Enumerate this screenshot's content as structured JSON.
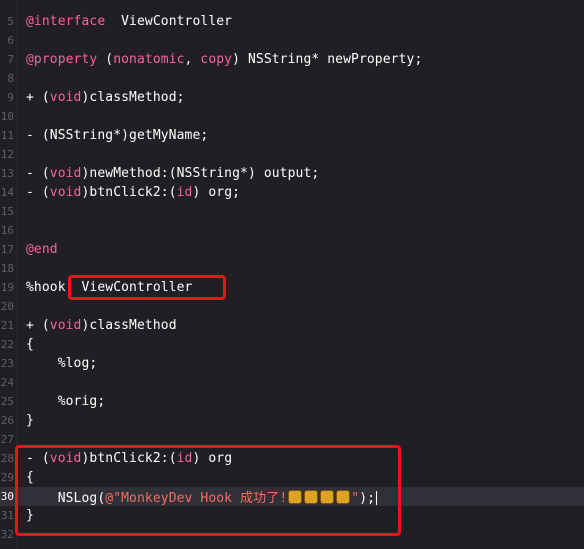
{
  "editor": {
    "lines": [
      {
        "num": "5",
        "segments": [
          {
            "t": "@interface",
            "c": "kw"
          },
          {
            "t": "  ViewController",
            "c": "plain"
          }
        ]
      },
      {
        "num": "6",
        "segments": []
      },
      {
        "num": "7",
        "segments": [
          {
            "t": "@property",
            "c": "kw"
          },
          {
            "t": " (",
            "c": "plain"
          },
          {
            "t": "nonatomic",
            "c": "kw"
          },
          {
            "t": ", ",
            "c": "plain"
          },
          {
            "t": "copy",
            "c": "kw"
          },
          {
            "t": ") NSString* newProperty;",
            "c": "plain"
          }
        ]
      },
      {
        "num": "8",
        "segments": []
      },
      {
        "num": "9",
        "segments": [
          {
            "t": "+ (",
            "c": "plain"
          },
          {
            "t": "void",
            "c": "kw"
          },
          {
            "t": ")classMethod;",
            "c": "plain"
          }
        ]
      },
      {
        "num": "10",
        "segments": []
      },
      {
        "num": "11",
        "segments": [
          {
            "t": "- (NSString*)getMyName;",
            "c": "plain"
          }
        ]
      },
      {
        "num": "12",
        "segments": []
      },
      {
        "num": "13",
        "segments": [
          {
            "t": "- (",
            "c": "plain"
          },
          {
            "t": "void",
            "c": "kw"
          },
          {
            "t": ")newMethod:(NSString*) output;",
            "c": "plain"
          }
        ]
      },
      {
        "num": "14",
        "segments": [
          {
            "t": "- (",
            "c": "plain"
          },
          {
            "t": "void",
            "c": "kw"
          },
          {
            "t": ")btnClick2:(",
            "c": "plain"
          },
          {
            "t": "id",
            "c": "kw"
          },
          {
            "t": ") org;",
            "c": "plain"
          }
        ]
      },
      {
        "num": "15",
        "segments": []
      },
      {
        "num": "16",
        "segments": []
      },
      {
        "num": "17",
        "segments": [
          {
            "t": "@end",
            "c": "kw"
          }
        ]
      },
      {
        "num": "18",
        "segments": []
      },
      {
        "num": "19",
        "segments": [
          {
            "t": "%hook  ViewController",
            "c": "plain"
          }
        ]
      },
      {
        "num": "20",
        "segments": []
      },
      {
        "num": "21",
        "segments": [
          {
            "t": "+ (",
            "c": "plain"
          },
          {
            "t": "void",
            "c": "kw"
          },
          {
            "t": ")classMethod",
            "c": "plain"
          }
        ]
      },
      {
        "num": "22",
        "segments": [
          {
            "t": "{",
            "c": "plain"
          }
        ]
      },
      {
        "num": "23",
        "segments": [
          {
            "t": "    %log;",
            "c": "plain"
          }
        ]
      },
      {
        "num": "24",
        "segments": []
      },
      {
        "num": "25",
        "segments": [
          {
            "t": "    %orig;",
            "c": "plain"
          }
        ]
      },
      {
        "num": "26",
        "segments": [
          {
            "t": "}",
            "c": "plain"
          }
        ]
      },
      {
        "num": "27",
        "segments": []
      },
      {
        "num": "28",
        "segments": [
          {
            "t": "- (",
            "c": "plain"
          },
          {
            "t": "void",
            "c": "kw"
          },
          {
            "t": ")btnClick2:(",
            "c": "plain"
          },
          {
            "t": "id",
            "c": "kw"
          },
          {
            "t": ") org",
            "c": "plain"
          }
        ]
      },
      {
        "num": "29",
        "segments": [
          {
            "t": "{",
            "c": "plain"
          }
        ]
      },
      {
        "num": "30",
        "current": true,
        "segments": [
          {
            "t": "    NSLog(",
            "c": "plain"
          },
          {
            "t": "@\"MonkeyDev Hook 成功了!",
            "c": "str"
          },
          {
            "t": "",
            "c": "emoji4"
          },
          {
            "t": "\"",
            "c": "str"
          },
          {
            "t": ");",
            "c": "plain"
          }
        ]
      },
      {
        "num": "31",
        "segments": [
          {
            "t": "}",
            "c": "plain"
          }
        ]
      },
      {
        "num": "32",
        "segments": []
      }
    ],
    "current_line": "30",
    "emoji_name": "beer-mug"
  }
}
